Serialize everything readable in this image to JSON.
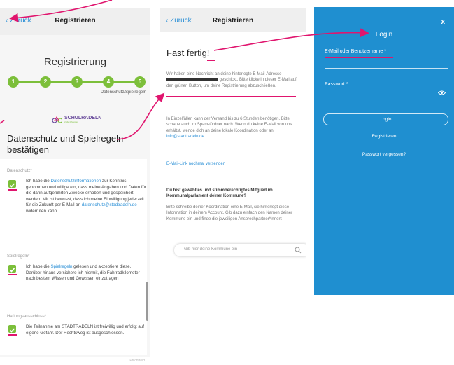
{
  "panel1": {
    "back_label": "Zurück",
    "nav_title": "Registrieren",
    "title": "Registrierung",
    "steps": [
      "1",
      "2",
      "3",
      "4",
      "5"
    ],
    "steps_caption": "Datenschutz/Spielregeln",
    "logo_text": "SCHULRADELN",
    "logo_sub": "cycle it happen",
    "heading": "Datenschutz und Spielregeln bestätigen",
    "privacy": {
      "label": "Datenschutz*",
      "text_a": "Ich habe die ",
      "link": "Datenschutzinformationen",
      "text_b": " zur Kenntnis genommen und willige ein, dass meine Angaben und Daten für die darin aufgeführten Zwecke erhoben und gespeichert werden. Mir ist bewusst, dass ich meine Einwilligung jederzeit für die Zukunft per E-Mail an ",
      "email": "datenschutz@stadtradeln.de",
      "text_c": " widerrufen kann"
    },
    "rules": {
      "label": "Spielregeln*",
      "text_a": "Ich habe die ",
      "link": "Spielregeln",
      "text_b": " gelesen und akzeptiere diese. Darüber hinaus versichere ich hiermit, die Fahrradkilometer nach bestem Wissen und Gewissen einzutragen"
    },
    "liability": {
      "label": "Haftungsausschluss*",
      "text": "Die Teilnahme am STADTRADELN ist freiwillig und erfolgt auf eigene Gefahr. Der Rechtsweg ist ausgeschlossen."
    },
    "footer_text": "Pflichtfeld"
  },
  "panel2": {
    "back_label": "Zurück",
    "nav_title": "Registrieren",
    "heading": "Fast fertig!",
    "p1_a": "Wir haben eine Nachricht an deine hinterlegte E-Mail-Adresse ",
    "p1_b": " geschickt. ",
    "p1_c": "Bitte klicke in dieser E-Mail auf den grünen Button, um deine Registrierung abzuschließen.",
    "p2_a": "In Einzelfällen kann der Versand bis zu 6 Stunden benötigen. Bitte schaue auch im Spam-Ordner nach. Wenn du keine E-Mail von uns erhältst, wende dich an deine lokale Koordination oder an ",
    "p2_link": "info@stadtradeln.de",
    "p2_b": ".",
    "resend_link": "E-Mail-Link nochmal versenden",
    "question": "Du bist gewähltes und stimmberechtigtes Mitglied im Kommunalparlament deiner Kommune?",
    "p3": "Bitte schreibe deiner Koordination eine E-Mail, sie hinterlegt diese Information in deinem Account. Gib dazu einfach den Namen deiner Kommune ein und finde die jeweiligen Ansprechpartner*innen:",
    "search_placeholder": "Gib hier deine Kommune ein"
  },
  "panel3": {
    "close_label": "x",
    "title": "Login",
    "email_label": "E-Mail oder Benutzername *",
    "password_label": "Passwort *",
    "login_button": "Login",
    "register_link": "Registrieren",
    "forgot_link": "Passwort vergessen?"
  },
  "colors": {
    "accent_blue": "#1f8fd0",
    "step_green": "#7cbf3a",
    "annotation_magenta": "#e0156e",
    "link_blue": "#2a8fd6"
  }
}
